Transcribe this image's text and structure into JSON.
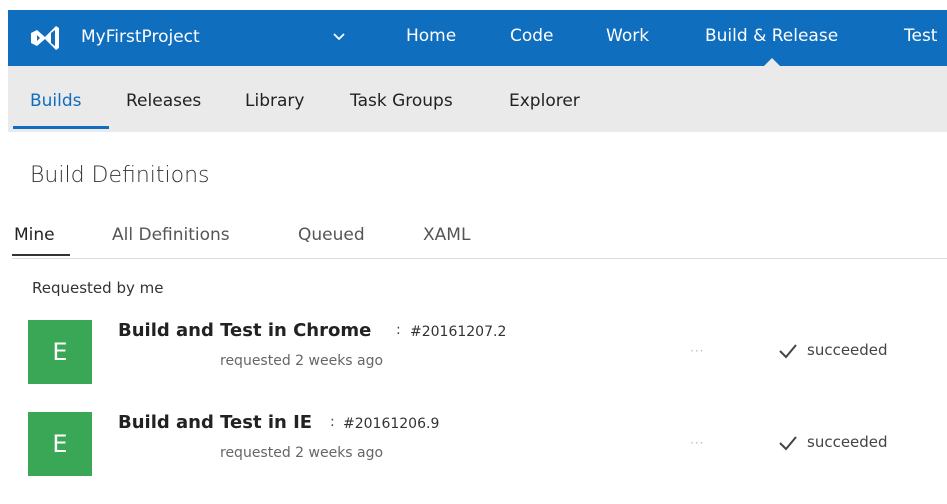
{
  "top_nav": {
    "project_name": "MyFirstProject",
    "items": [
      {
        "label": "Home"
      },
      {
        "label": "Code"
      },
      {
        "label": "Work"
      },
      {
        "label": "Build & Release"
      },
      {
        "label": "Test"
      }
    ],
    "active_item": "Build & Release",
    "bar_color": "#106ebe"
  },
  "sub_nav": {
    "items": [
      {
        "label": "Builds"
      },
      {
        "label": "Releases"
      },
      {
        "label": "Library"
      },
      {
        "label": "Task Groups"
      },
      {
        "label": "Explorer"
      }
    ],
    "active_item": "Builds"
  },
  "page": {
    "title": "Build Definitions",
    "pivots": [
      {
        "label": "Mine"
      },
      {
        "label": "All Definitions"
      },
      {
        "label": "Queued"
      },
      {
        "label": "XAML"
      }
    ],
    "active_pivot": "Mine",
    "section_label": "Requested by me"
  },
  "builds": [
    {
      "avatar_letter": "E",
      "name": "Build and Test in Chrome",
      "separator": ":",
      "build_number": "#20161207.2",
      "requested": "requested 2 weeks ago",
      "more": "···",
      "status": "succeeded"
    },
    {
      "avatar_letter": "E",
      "name": "Build and Test in IE",
      "separator": ":",
      "build_number": "#20161206.9",
      "requested": "requested 2 weeks ago",
      "more": "···",
      "status": "succeeded"
    }
  ],
  "colors": {
    "accent": "#106ebe",
    "avatar": "#3aa757",
    "subnav_bg": "#eaeaea"
  },
  "icons": {
    "logo": "visual-studio-logo-icon",
    "project_menu": "chevron-down-icon",
    "status": "checkmark-icon"
  }
}
